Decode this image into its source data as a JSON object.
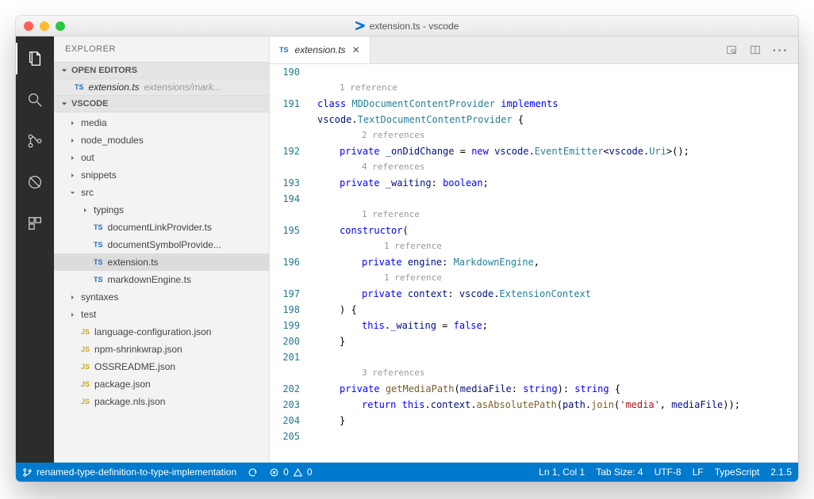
{
  "window": {
    "title": "extension.ts - vscode"
  },
  "sidebar": {
    "title": "EXPLORER",
    "openEditorsLabel": "OPEN EDITORS",
    "projectLabel": "VSCODE",
    "openEditor": {
      "name": "extension.ts",
      "hint": "extensions/mark..."
    },
    "tree": [
      {
        "label": "media",
        "kind": "folder",
        "depth": 1,
        "expanded": false
      },
      {
        "label": "node_modules",
        "kind": "folder",
        "depth": 1,
        "expanded": false
      },
      {
        "label": "out",
        "kind": "folder",
        "depth": 1,
        "expanded": false
      },
      {
        "label": "snippets",
        "kind": "folder",
        "depth": 1,
        "expanded": false
      },
      {
        "label": "src",
        "kind": "folder",
        "depth": 1,
        "expanded": true
      },
      {
        "label": "typings",
        "kind": "folder",
        "depth": 2,
        "expanded": false
      },
      {
        "label": "documentLinkProvider.ts",
        "kind": "ts",
        "depth": 2
      },
      {
        "label": "documentSymbolProvide...",
        "kind": "ts",
        "depth": 2
      },
      {
        "label": "extension.ts",
        "kind": "ts",
        "depth": 2,
        "selected": true
      },
      {
        "label": "markdownEngine.ts",
        "kind": "ts",
        "depth": 2
      },
      {
        "label": "syntaxes",
        "kind": "folder",
        "depth": 1,
        "expanded": false
      },
      {
        "label": "test",
        "kind": "folder",
        "depth": 1,
        "expanded": false
      },
      {
        "label": "language-configuration.json",
        "kind": "js",
        "depth": 1
      },
      {
        "label": "npm-shrinkwrap.json",
        "kind": "js",
        "depth": 1
      },
      {
        "label": "OSSREADME.json",
        "kind": "js",
        "depth": 1
      },
      {
        "label": "package.json",
        "kind": "js",
        "depth": 1
      },
      {
        "label": "package.nls.json",
        "kind": "js",
        "depth": 1
      }
    ]
  },
  "tab": {
    "label": "extension.ts"
  },
  "code": {
    "firstLine": 190,
    "rows": [
      {
        "n": 190,
        "gutterOnly": true
      },
      {
        "codelens": "1 reference",
        "indent": 0
      },
      {
        "n": 191,
        "indent": 0,
        "tokens": [
          [
            "k",
            "class "
          ],
          [
            "t",
            "MDDocumentContentProvider"
          ],
          [
            "p",
            " "
          ],
          [
            "k",
            "implements"
          ]
        ]
      },
      {
        "indent": 0,
        "tokens": [
          [
            "v",
            "vscode"
          ],
          [
            "p",
            "."
          ],
          [
            "t",
            "TextDocumentContentProvider"
          ],
          [
            "p",
            " {"
          ]
        ]
      },
      {
        "codelens": "2 references",
        "indent": 1
      },
      {
        "n": 192,
        "indent": 1,
        "tokens": [
          [
            "k",
            "private"
          ],
          [
            "p",
            " "
          ],
          [
            "v",
            "_onDidChange"
          ],
          [
            "p",
            " = "
          ],
          [
            "k",
            "new"
          ],
          [
            "p",
            " "
          ],
          [
            "v",
            "vscode"
          ],
          [
            "p",
            "."
          ],
          [
            "t",
            "EventEmitter"
          ],
          [
            "p",
            "<"
          ],
          [
            "v",
            "vscode"
          ],
          [
            "p",
            "."
          ],
          [
            "t",
            "Uri"
          ],
          [
            "p",
            ">();"
          ]
        ]
      },
      {
        "codelens": "4 references",
        "indent": 1
      },
      {
        "n": 193,
        "indent": 1,
        "tokens": [
          [
            "k",
            "private"
          ],
          [
            "p",
            " "
          ],
          [
            "v",
            "_waiting"
          ],
          [
            "p",
            ": "
          ],
          [
            "b",
            "boolean"
          ],
          [
            "p",
            ";"
          ]
        ]
      },
      {
        "n": 194,
        "indent": 0,
        "tokens": []
      },
      {
        "codelens": "1 reference",
        "indent": 1
      },
      {
        "n": 195,
        "indent": 1,
        "tokens": [
          [
            "k",
            "constructor"
          ],
          [
            "p",
            "("
          ]
        ]
      },
      {
        "codelens": "1 reference",
        "indent": 2
      },
      {
        "n": 196,
        "indent": 2,
        "tokens": [
          [
            "k",
            "private"
          ],
          [
            "p",
            " "
          ],
          [
            "v",
            "engine"
          ],
          [
            "p",
            ": "
          ],
          [
            "t",
            "MarkdownEngine"
          ],
          [
            "p",
            ","
          ]
        ]
      },
      {
        "codelens": "1 reference",
        "indent": 2
      },
      {
        "n": 197,
        "indent": 2,
        "tokens": [
          [
            "k",
            "private"
          ],
          [
            "p",
            " "
          ],
          [
            "v",
            "context"
          ],
          [
            "p",
            ": "
          ],
          [
            "v",
            "vscode"
          ],
          [
            "p",
            "."
          ],
          [
            "t",
            "ExtensionContext"
          ]
        ]
      },
      {
        "n": 198,
        "indent": 1,
        "tokens": [
          [
            "p",
            ") {"
          ]
        ]
      },
      {
        "n": 199,
        "indent": 2,
        "tokens": [
          [
            "b",
            "this"
          ],
          [
            "p",
            "."
          ],
          [
            "v",
            "_waiting"
          ],
          [
            "p",
            " = "
          ],
          [
            "b",
            "false"
          ],
          [
            "p",
            ";"
          ]
        ]
      },
      {
        "n": 200,
        "indent": 1,
        "tokens": [
          [
            "p",
            "}"
          ]
        ]
      },
      {
        "n": 201,
        "indent": 0,
        "tokens": []
      },
      {
        "codelens": "3 references",
        "indent": 1
      },
      {
        "n": 202,
        "indent": 1,
        "tokens": [
          [
            "k",
            "private"
          ],
          [
            "p",
            " "
          ],
          [
            "f",
            "getMediaPath"
          ],
          [
            "p",
            "("
          ],
          [
            "v",
            "mediaFile"
          ],
          [
            "p",
            ": "
          ],
          [
            "b",
            "string"
          ],
          [
            "p",
            "): "
          ],
          [
            "b",
            "string"
          ],
          [
            "p",
            " {"
          ]
        ]
      },
      {
        "n": 203,
        "indent": 2,
        "tokens": [
          [
            "k",
            "return"
          ],
          [
            "p",
            " "
          ],
          [
            "b",
            "this"
          ],
          [
            "p",
            "."
          ],
          [
            "v",
            "context"
          ],
          [
            "p",
            "."
          ],
          [
            "f",
            "asAbsolutePath"
          ],
          [
            "p",
            "("
          ],
          [
            "v",
            "path"
          ],
          [
            "p",
            "."
          ],
          [
            "f",
            "join"
          ],
          [
            "p",
            "("
          ],
          [
            "s",
            "'media'"
          ],
          [
            "p",
            ", "
          ],
          [
            "v",
            "mediaFile"
          ],
          [
            "p",
            "));"
          ]
        ]
      },
      {
        "n": 204,
        "indent": 1,
        "tokens": [
          [
            "p",
            "}"
          ]
        ]
      },
      {
        "n": 205,
        "indent": 0,
        "tokens": []
      }
    ]
  },
  "status": {
    "branch": "renamed-type-definition-to-type-implementation",
    "errors": "0",
    "warnings": "0",
    "lineCol": "Ln 1, Col 1",
    "tabSize": "Tab Size: 4",
    "encoding": "UTF-8",
    "eol": "LF",
    "language": "TypeScript",
    "version": "2.1.5"
  }
}
